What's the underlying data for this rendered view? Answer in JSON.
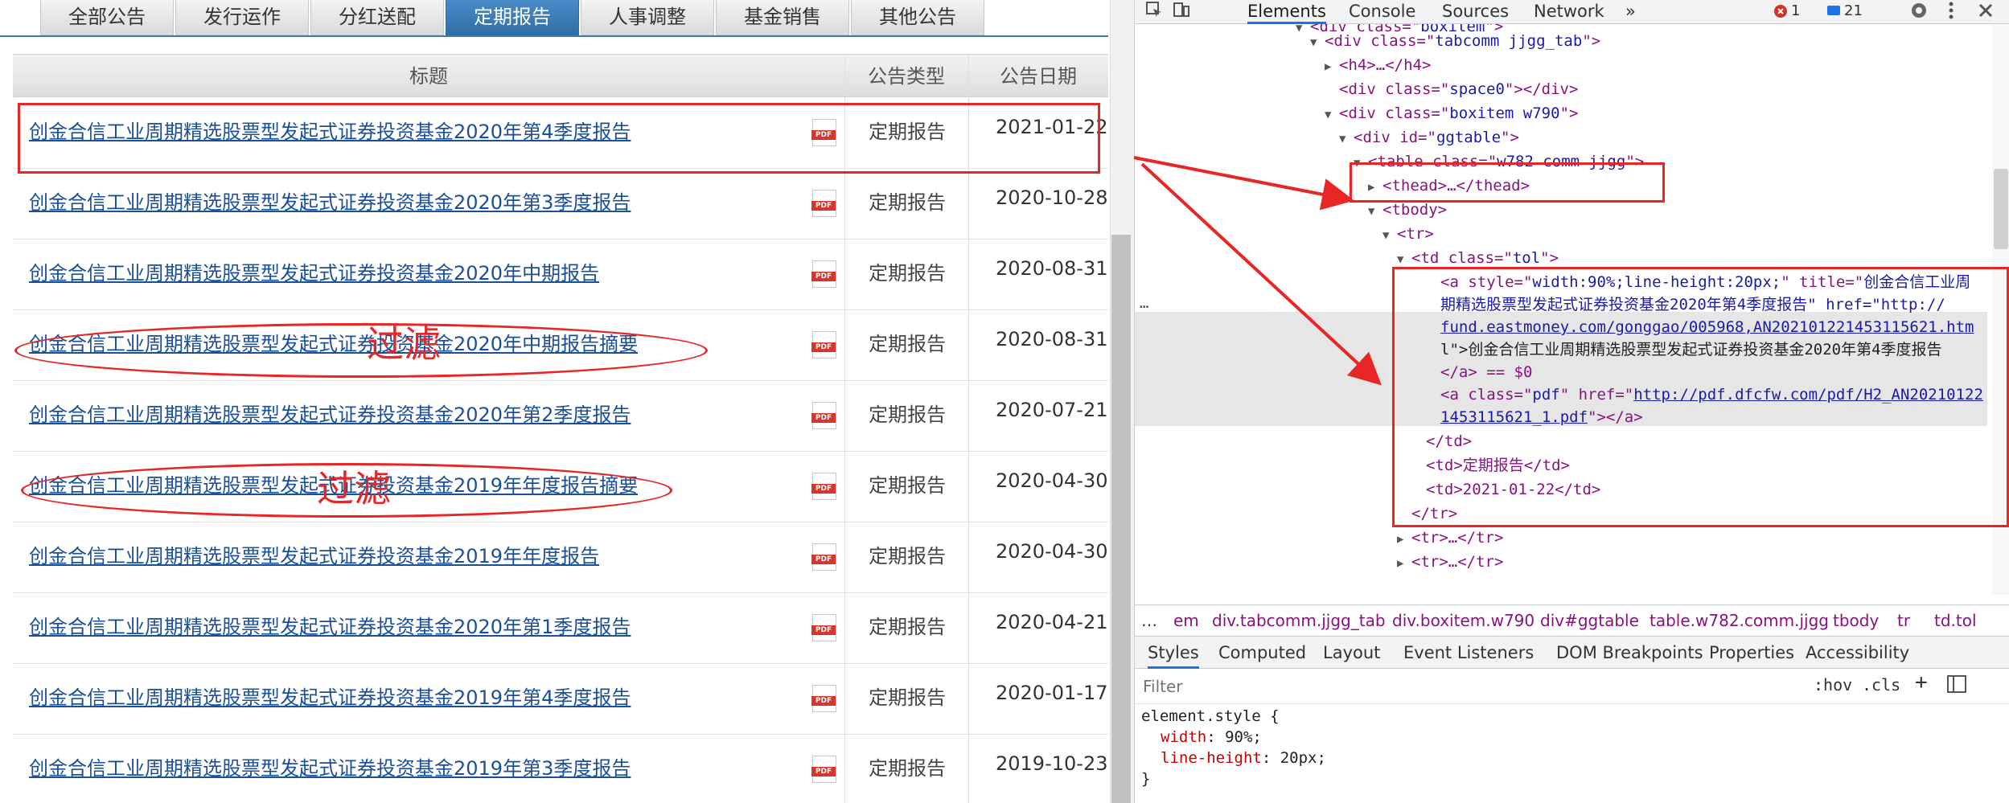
{
  "tabs": [
    "全部公告",
    "发行运作",
    "分红送配",
    "定期报告",
    "人事调整",
    "基金销售",
    "其他公告"
  ],
  "active_tab_index": 3,
  "table": {
    "headers": [
      "标题",
      "公告类型",
      "公告日期"
    ],
    "pdf_label": "PDF",
    "rows": [
      {
        "title": "创金合信工业周期精选股票型发起式证券投资基金2020年第4季度报告",
        "type": "定期报告",
        "date": "2021-01-22"
      },
      {
        "title": "创金合信工业周期精选股票型发起式证券投资基金2020年第3季度报告",
        "type": "定期报告",
        "date": "2020-10-28"
      },
      {
        "title": "创金合信工业周期精选股票型发起式证券投资基金2020年中期报告",
        "type": "定期报告",
        "date": "2020-08-31"
      },
      {
        "title": "创金合信工业周期精选股票型发起式证券投资基金2020年中期报告摘要",
        "type": "定期报告",
        "date": "2020-08-31"
      },
      {
        "title": "创金合信工业周期精选股票型发起式证券投资基金2020年第2季度报告",
        "type": "定期报告",
        "date": "2020-07-21"
      },
      {
        "title": "创金合信工业周期精选股票型发起式证券投资基金2019年年度报告摘要",
        "type": "定期报告",
        "date": "2020-04-30"
      },
      {
        "title": "创金合信工业周期精选股票型发起式证券投资基金2019年年度报告",
        "type": "定期报告",
        "date": "2020-04-30"
      },
      {
        "title": "创金合信工业周期精选股票型发起式证券投资基金2020年第1季度报告",
        "type": "定期报告",
        "date": "2020-04-21"
      },
      {
        "title": "创金合信工业周期精选股票型发起式证券投资基金2019年第4季度报告",
        "type": "定期报告",
        "date": "2020-01-17"
      },
      {
        "title": "创金合信工业周期精选股票型发起式证券投资基金2019年第3季度报告",
        "type": "定期报告",
        "date": "2019-10-23"
      }
    ]
  },
  "annotations": {
    "filter_label": "过滤"
  },
  "devtools": {
    "tabs": [
      "Elements",
      "Console",
      "Sources",
      "Network"
    ],
    "more": "»",
    "error_count": "1",
    "message_count": "21",
    "dom": {
      "l1": [
        "<div class=\"",
        "boxitem",
        "\">"
      ],
      "l2": [
        "<div class=\"",
        "tabcomm jjgg_tab",
        "\">"
      ],
      "l3": "<h4>…</h4>",
      "l4": [
        "<div class=\"",
        "space0",
        "\"></div>"
      ],
      "l5": [
        "<div class=\"",
        "boxitem w790",
        "\">"
      ],
      "l6": [
        "<div id=\"",
        "ggtable",
        "\">"
      ],
      "l7": [
        "<table class=\"",
        "w782 comm jjgg",
        "\">"
      ],
      "l8": "<thead>…</thead>",
      "l9": "<tbody>",
      "l10": "<tr>",
      "l11": [
        "<td class=\"",
        "tol",
        "\">"
      ],
      "l12a": "<a style=\"",
      "l12b": "width:90%;line-height:20px;",
      "l12c": "\" title=\"",
      "l12d": "创金合信工业周",
      "l13": "期精选股票型发起式证券投资基金2020年第4季度报告\" href=\"http://",
      "l14": "fund.eastmoney.com/gonggao/005968,AN202101221453115621.htm",
      "l15": "l\">创金合信工业周期精选股票型发起式证券投资基金2020年第4季度报告",
      "l16": "</a> == $0",
      "l17a": "<a class=\"",
      "l17b": "pdf",
      "l17c": "\" href=\"",
      "l17d": "http://pdf.dfcfw.com/pdf/H2_AN20210122",
      "l18": "1453115621_1.pdf",
      "l18b": "\"></a>",
      "l19": "</td>",
      "l20": "<td>定期报告</td>",
      "l21": "<td>2021-01-22</td>",
      "l22": "</tr>",
      "l23": "<tr>…</tr>",
      "l24": "<tr>…</tr>",
      "ellipsis": "…"
    },
    "breadcrumbs": [
      "…",
      "em",
      "div.tabcomm.jjgg_tab",
      "div.boxitem.w790",
      "div#ggtable",
      "table.w782.comm.jjgg",
      "tbody",
      "tr",
      "td.tol"
    ],
    "style_tabs": [
      "Styles",
      "Computed",
      "Layout",
      "Event Listeners",
      "DOM Breakpoints",
      "Properties",
      "Accessibility"
    ],
    "filter_placeholder": "Filter",
    "hov": ":hov",
    "cls": ".cls",
    "plus": "+",
    "element_style_selector": "element.style {",
    "props": [
      {
        "name": "width",
        "value": "90%;"
      },
      {
        "name": "line-height",
        "value": "20px;"
      }
    ],
    "close_brace": "}"
  },
  "colors": {
    "annotation": "#e82626",
    "active_tab": "#3d7ab8",
    "link": "#1a4f9a"
  }
}
